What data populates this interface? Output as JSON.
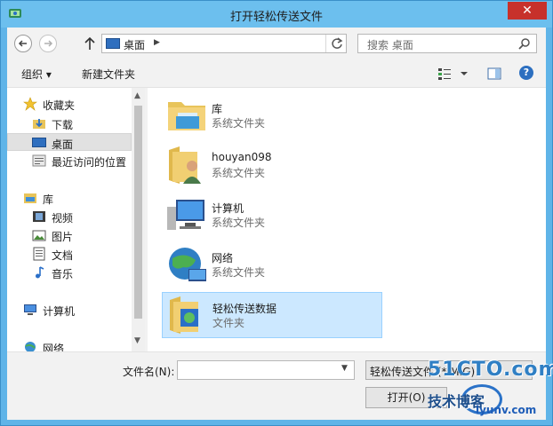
{
  "window": {
    "title": "打开轻松传送文件",
    "close_symbol": "✕"
  },
  "address": {
    "location": "桌面",
    "search_placeholder": "搜索 桌面"
  },
  "toolbar": {
    "organize_label": "组织 ▾",
    "new_folder_label": "新建文件夹",
    "help_symbol": "?"
  },
  "nav": {
    "favorites_label": "收藏夹",
    "downloads_label": "下载",
    "desktop_label": "桌面",
    "recent_label": "最近访问的位置",
    "libraries_label": "库",
    "videos_label": "视频",
    "pictures_label": "图片",
    "documents_label": "文档",
    "music_label": "音乐",
    "computer_label": "计算机",
    "network_label": "网络"
  },
  "files": [
    {
      "name": "库",
      "type": "系统文件夹",
      "icon": "library-icon"
    },
    {
      "name": "houyan098",
      "type": "系统文件夹",
      "icon": "user-folder-icon"
    },
    {
      "name": "计算机",
      "type": "系统文件夹",
      "icon": "computer-icon"
    },
    {
      "name": "网络",
      "type": "系统文件夹",
      "icon": "network-icon"
    },
    {
      "name": "轻松传送数据",
      "type": "文件夹",
      "icon": "folder-icon",
      "selected": true
    }
  ],
  "bottom": {
    "filename_label": "文件名(N):",
    "filename_value": "",
    "filter_value": "轻松传送文件 (*.MIG)",
    "open_label": "打开(O)"
  },
  "watermark": {
    "site": "51CTO.com",
    "blog": "技术博客",
    "iyunv": "iyunv.com"
  },
  "colors": {
    "titlebar": "#6cbfee",
    "selection": "#cce8ff",
    "close": "#c7312b"
  }
}
